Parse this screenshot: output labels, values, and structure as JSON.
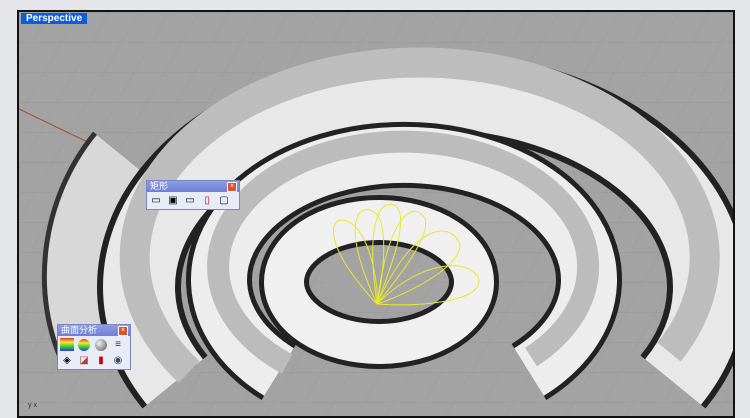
{
  "viewport": {
    "title": "Perspective"
  },
  "rect_toolbar": {
    "title": "矩形",
    "buttons": [
      "rectangle-corner",
      "rectangle-center",
      "rectangle-3pt",
      "rectangle-vertical",
      "rounded-rectangle"
    ]
  },
  "surface_toolbar": {
    "title": "曲面分析",
    "buttons": [
      "zebra",
      "curvature",
      "environment-map",
      "draft-angle",
      "emap",
      "curvature-graph",
      "edge-analysis",
      "render"
    ]
  },
  "axis": {
    "x": "x",
    "y": "y"
  },
  "colors": {
    "viewport_bg": "#a3a3a3",
    "title_bg": "#0a5fd8",
    "curve": "#e8e830"
  }
}
